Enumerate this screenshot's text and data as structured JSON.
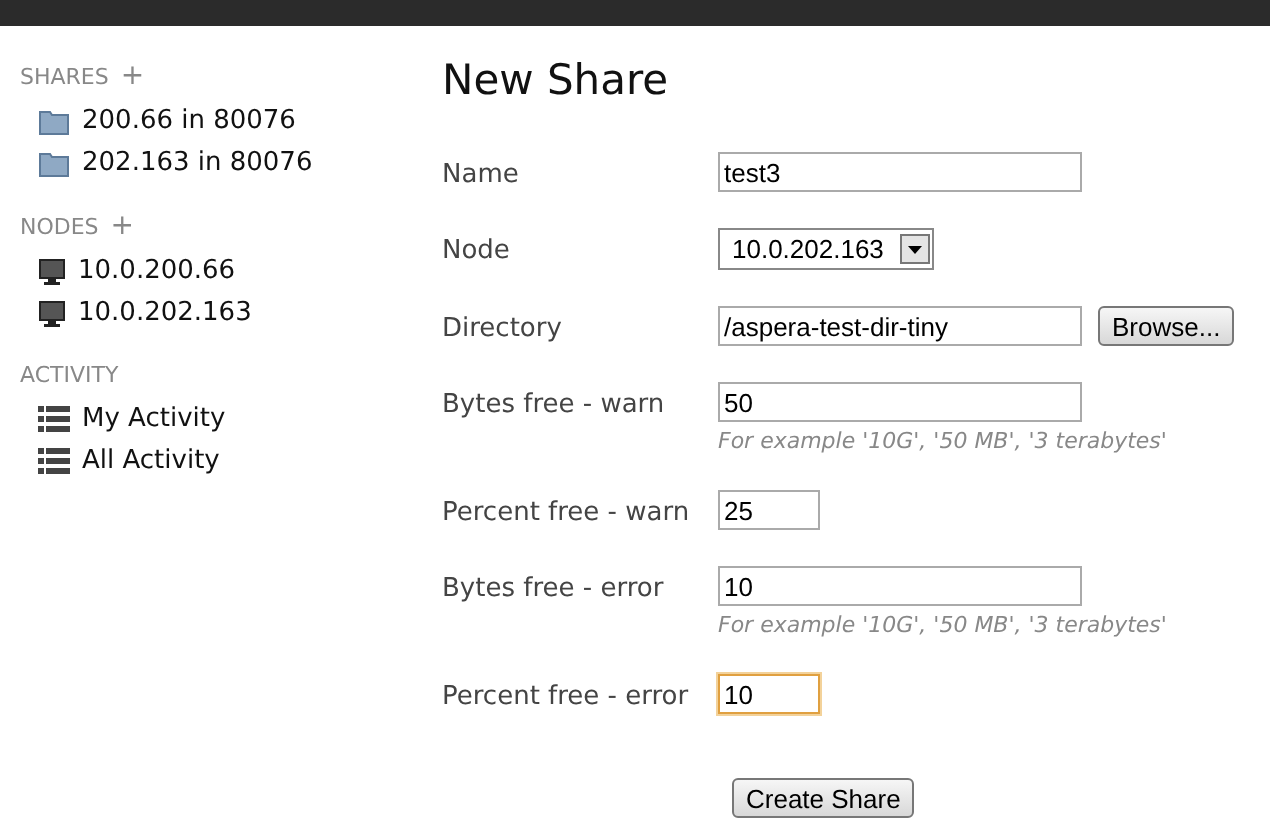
{
  "sidebar": {
    "sections": [
      {
        "title": "SHARES",
        "add": "+",
        "items": [
          {
            "kind": "folder",
            "label": "200.66 in 80076"
          },
          {
            "kind": "folder",
            "label": "202.163 in 80076"
          }
        ]
      },
      {
        "title": "NODES",
        "add": "+",
        "items": [
          {
            "kind": "node",
            "label": "10.0.200.66"
          },
          {
            "kind": "node",
            "label": "10.0.202.163"
          }
        ]
      },
      {
        "title": "ACTIVITY",
        "items": [
          {
            "kind": "list",
            "label": "My Activity"
          },
          {
            "kind": "list",
            "label": "All Activity"
          }
        ]
      }
    ]
  },
  "form": {
    "title": "New Share",
    "fields": [
      {
        "label": "Name",
        "kind": "text",
        "value": "test3",
        "focused": false
      },
      {
        "label": "Node",
        "kind": "select",
        "value": "10.0.202.163",
        "focused": false
      },
      {
        "label": "Directory",
        "kind": "text",
        "value": "/aspera-test-dir-tiny",
        "button": "Browse...",
        "focused": false
      },
      {
        "label": "Bytes free - warn",
        "kind": "text",
        "value": "50",
        "hint": "For example '10G', '50 MB', '3 terabytes'",
        "focused": false
      },
      {
        "label": "Percent free - warn",
        "kind": "short",
        "value": "25",
        "focused": false
      },
      {
        "label": "Bytes free - error",
        "kind": "text",
        "value": "10",
        "hint": "For example '10G', '50 MB', '3 terabytes'",
        "focused": false
      },
      {
        "label": "Percent free - error",
        "kind": "short",
        "value": "10",
        "focused": true
      }
    ],
    "submit": "Create Share"
  }
}
